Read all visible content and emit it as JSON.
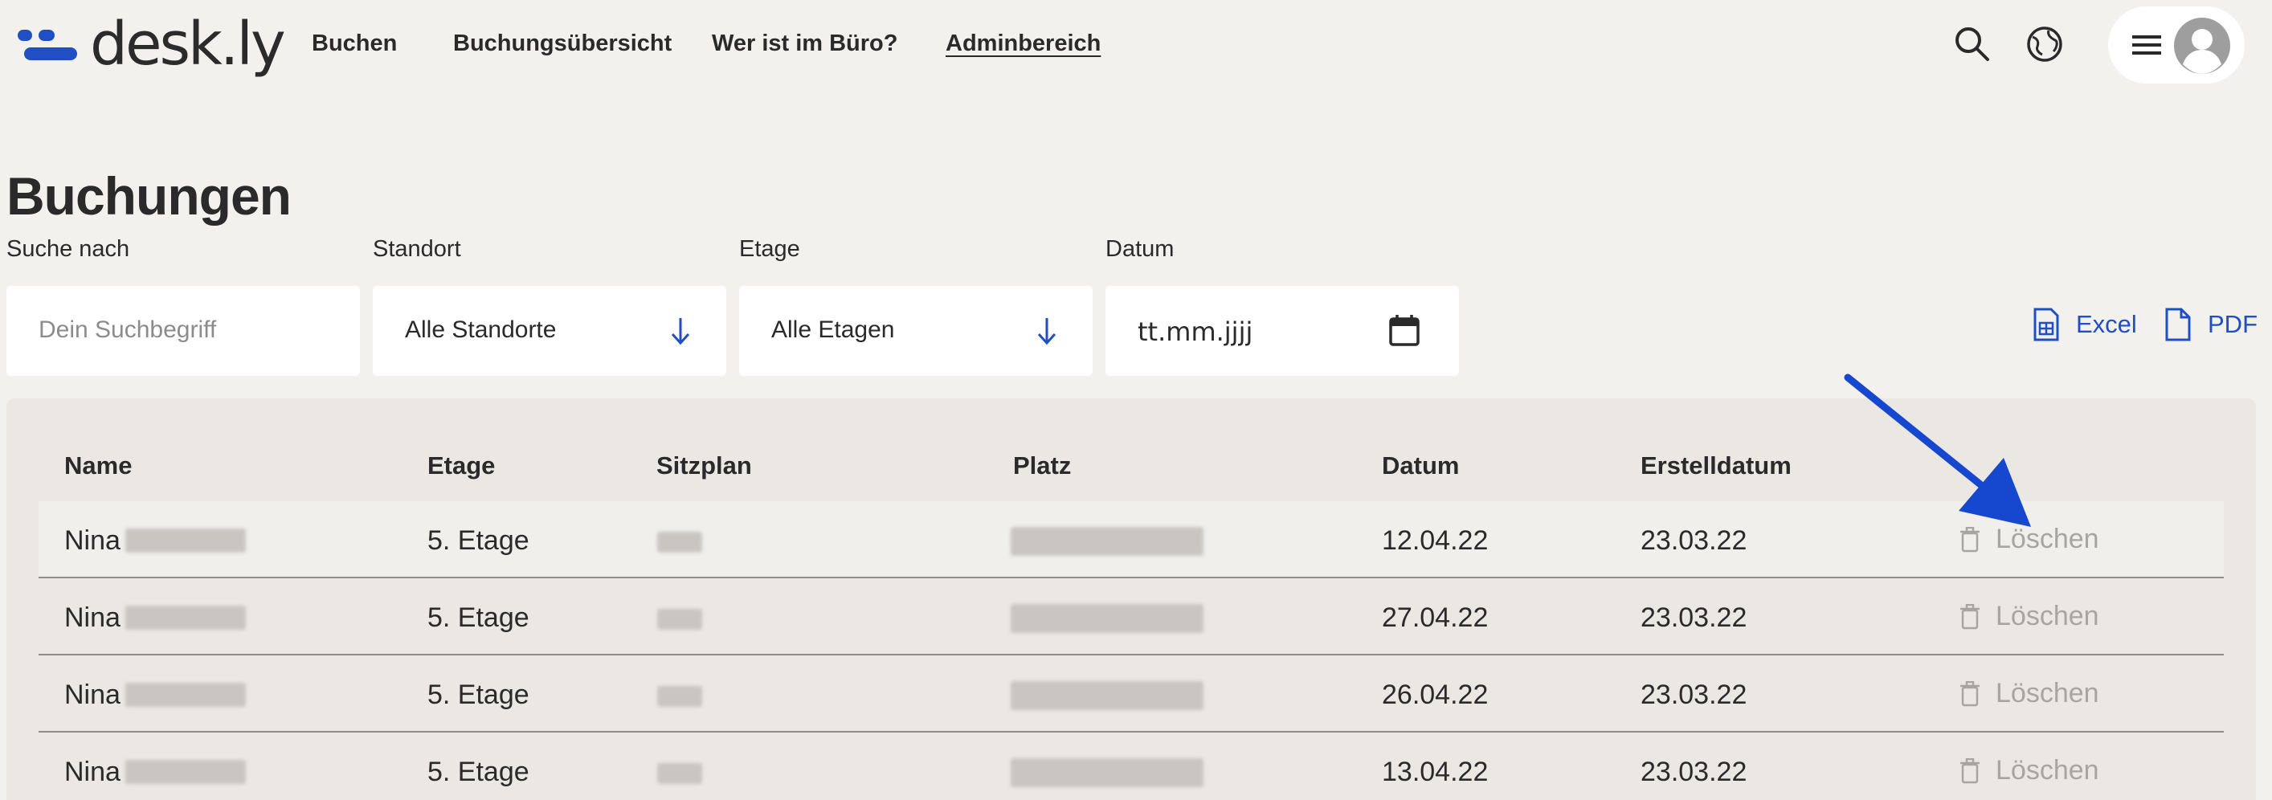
{
  "app": {
    "logo_text": "desk.ly"
  },
  "nav": [
    {
      "label": "Buchen"
    },
    {
      "label": "Buchungsübersicht"
    },
    {
      "label": "Wer ist im Büro?"
    },
    {
      "label": "Adminbereich",
      "active": true
    }
  ],
  "header_icons": [
    "search-icon",
    "globe-icon",
    "menu-icon",
    "user-avatar-icon"
  ],
  "page": {
    "title": "Buchungen"
  },
  "filters": {
    "search": {
      "label": "Suche nach",
      "placeholder": "Dein Suchbegriff"
    },
    "location": {
      "label": "Standort",
      "value": "Alle Standorte"
    },
    "floor": {
      "label": "Etage",
      "value": "Alle Etagen"
    },
    "date": {
      "label": "Datum",
      "placeholder": "tt.mm.jjjj"
    }
  },
  "exports": {
    "excel": "Excel",
    "pdf": "PDF"
  },
  "table": {
    "columns": [
      "Name",
      "Etage",
      "Sitzplan",
      "Platz",
      "Datum",
      "Erstelldatum"
    ],
    "delete_label": "Löschen",
    "rows": [
      {
        "name": "Nina",
        "floor": "5. Etage",
        "date": "12.04.22",
        "created": "23.03.22"
      },
      {
        "name": "Nina",
        "floor": "5. Etage",
        "date": "27.04.22",
        "created": "23.03.22"
      },
      {
        "name": "Nina",
        "floor": "5. Etage",
        "date": "26.04.22",
        "created": "23.03.22"
      },
      {
        "name": "Nina",
        "floor": "5. Etage",
        "date": "13.04.22",
        "created": "23.03.22"
      }
    ]
  },
  "colors": {
    "accent": "#1f4fc2",
    "background": "#f3f1ee",
    "muted": "#a8a5a1"
  }
}
